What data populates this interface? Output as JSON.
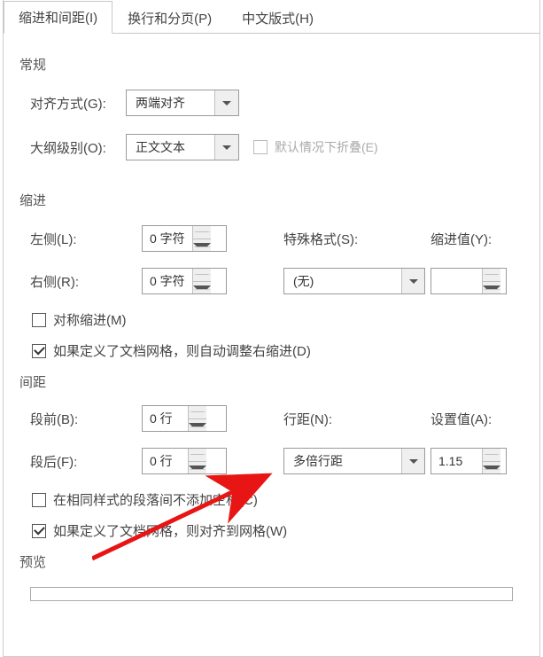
{
  "tabs": {
    "indent_spacing": "缩进和间距(I)",
    "line_page": "换行和分页(P)",
    "chinese": "中文版式(H)"
  },
  "general": {
    "title": "常规",
    "alignment_label": "对齐方式(G):",
    "alignment_value": "两端对齐",
    "outline_label": "大纲级别(O):",
    "outline_value": "正文文本",
    "collapse_label": "默认情况下折叠(E)"
  },
  "indent": {
    "title": "缩进",
    "left_label": "左侧(L):",
    "left_value": "0 字符",
    "right_label": "右侧(R):",
    "right_value": "0 字符",
    "special_label": "特殊格式(S):",
    "special_value": "(无)",
    "by_label": "缩进值(Y):",
    "by_value": "",
    "mirror_label": "对称缩进(M)",
    "auto_adjust_label": "如果定义了文档网格，则自动调整右缩进(D)"
  },
  "spacing": {
    "title": "间距",
    "before_label": "段前(B):",
    "before_value": "0 行",
    "after_label": "段后(F):",
    "after_value": "0 行",
    "line_label": "行距(N):",
    "line_value": "多倍行距",
    "at_label": "设置值(A):",
    "at_value": "1.15",
    "no_space_label": "在相同样式的段落间不添加空格(C)",
    "snap_grid_label": "如果定义了文档网格，则对齐到网格(W)"
  },
  "preview": {
    "title": "预览"
  }
}
